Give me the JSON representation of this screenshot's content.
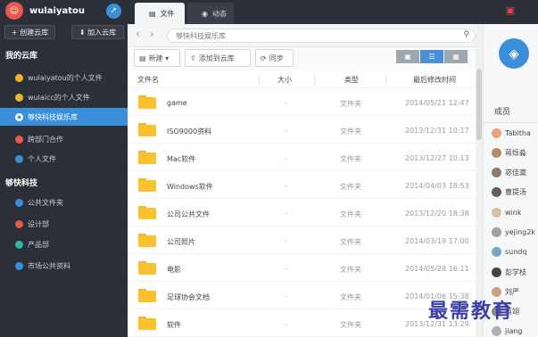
{
  "user": {
    "name": "wulaiyatou",
    "avatar_glyph": "☺",
    "rocket_glyph": "➚"
  },
  "sidebar": {
    "create_label": "+ 创建云库",
    "join_label": "⬇ 加入云库",
    "my_section": "我的云库",
    "my_items": [
      {
        "label": "wulaiyatou的个人文件",
        "color": "#f0b429"
      },
      {
        "label": "wulaicc的个人文件",
        "color": "#f0b429"
      },
      {
        "label": "够快科技娱乐库",
        "color": "#3b8fd9"
      },
      {
        "label": "跨部门合作",
        "color": "#e85a4a"
      },
      {
        "label": "个人文件",
        "color": "#3b8fd9"
      }
    ],
    "team_section": "够快科技",
    "team_items": [
      {
        "label": "公共文件夹",
        "color": "#3b8fd9"
      },
      {
        "label": "设计部",
        "color": "#e85a4a"
      },
      {
        "label": "产品部",
        "color": "#2bb5a3"
      },
      {
        "label": "市场公共资料",
        "color": "#3b8fd9"
      }
    ]
  },
  "tabs": [
    {
      "label": "文件",
      "icon": "file-tab-icon",
      "glyph": "▤"
    },
    {
      "label": "动态",
      "icon": "chat-icon",
      "glyph": "◉"
    }
  ],
  "nav": {
    "back": "‹",
    "forward": "›",
    "path": "够快科技娱乐库",
    "search_glyph": "⚲"
  },
  "toolbar": {
    "new_label": "新建 ▾",
    "add_label": "添加到云库",
    "sync_label": "同步",
    "new_glyph": "▤",
    "add_glyph": "⇪",
    "sync_glyph": "⟳",
    "view_glyphs": [
      "▣",
      "☰",
      "▦"
    ]
  },
  "table": {
    "headers": [
      "文件名",
      "大小",
      "类型",
      "最后修改时间"
    ],
    "rows": [
      {
        "name": "game",
        "size": "-",
        "type": "文件夹",
        "date": "2014/05/21 12:47"
      },
      {
        "name": "ISO9000资料",
        "size": "-",
        "type": "文件夹",
        "date": "2013/12/31 10:17"
      },
      {
        "name": "Mac软件",
        "size": "-",
        "type": "文件夹",
        "date": "2013/12/27 10:13"
      },
      {
        "name": "Windows软件",
        "size": "-",
        "type": "文件夹",
        "date": "2014/04/03 18:53"
      },
      {
        "name": "公司公共文件",
        "size": "-",
        "type": "文件夹",
        "date": "2013/12/20 18:38"
      },
      {
        "name": "公司照片",
        "size": "-",
        "type": "文件夹",
        "date": "2014/03/19 17:00"
      },
      {
        "name": "电影",
        "size": "-",
        "type": "文件夹",
        "date": "2014/05/28 16:11"
      },
      {
        "name": "足球协会文档",
        "size": "-",
        "type": "文件夹",
        "date": "2014/01/06 15:38"
      },
      {
        "name": "软件",
        "size": "-",
        "type": "文件夹",
        "date": "2013/12/31 13:29"
      }
    ]
  },
  "right_panel": {
    "logo_glyph": "◈",
    "members_label": "成员",
    "members": [
      "Tabitha",
      "蒋烁淼",
      "宓佳寞",
      "曹提汤",
      "wink",
      "yejing2k",
      "sundq",
      "彭学枝",
      "刘严",
      "蒋翊",
      "jiang"
    ]
  },
  "watermark": "最需教育"
}
